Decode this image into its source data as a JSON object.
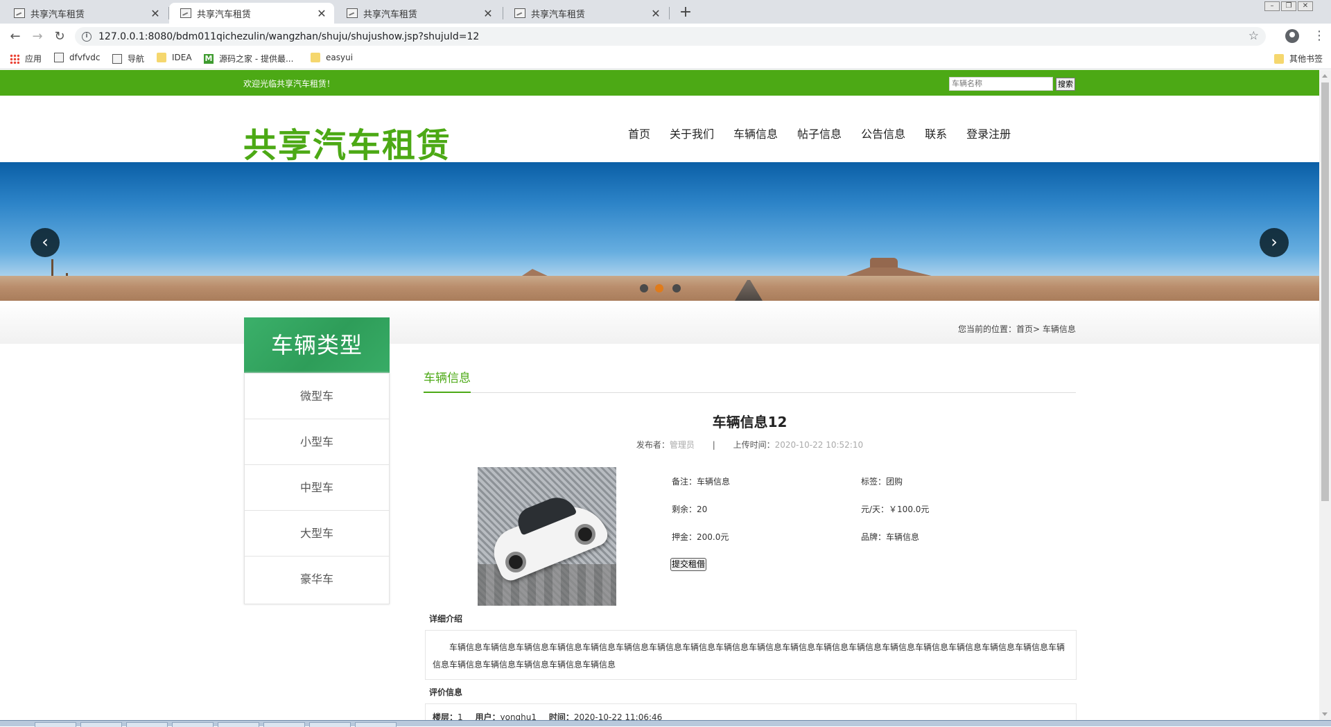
{
  "browser": {
    "tabs": [
      {
        "title": "共享汽车租赁",
        "active": false
      },
      {
        "title": "共享汽车租赁",
        "active": true
      },
      {
        "title": "共享汽车租赁",
        "active": false
      },
      {
        "title": "共享汽车租赁",
        "active": false
      }
    ],
    "url": "127.0.0.1:8080/bdm011qichezulin/wangzhan/shuju/shujushow.jsp?shujuId=12",
    "bookmarks": [
      "应用",
      "dfvfvdc",
      "导航",
      "IDEA",
      "源码之家 - 提供最...",
      "easyui"
    ],
    "other_bookmarks": "其他书签"
  },
  "topbar": {
    "welcome": "欢迎光临共享汽车租赁！",
    "search_placeholder": "车辆名称",
    "search_button": "搜索"
  },
  "header": {
    "logo": "共享汽车租赁",
    "nav": [
      "首页",
      "关于我们",
      "车辆信息",
      "帖子信息",
      "公告信息",
      "联系",
      "登录注册"
    ]
  },
  "banner": {
    "slides": 3,
    "active_slide": 2,
    "prev_icon": "chevron-left-icon",
    "next_icon": "chevron-right-icon"
  },
  "breadcrumb": {
    "prefix": "您当前的位置：",
    "home": "首页",
    "separator": ">",
    "current": "车辆信息"
  },
  "sidebar": {
    "title": "车辆类型",
    "items": [
      "微型车",
      "小型车",
      "中型车",
      "大型车",
      "豪华车"
    ]
  },
  "main": {
    "section_label": "车辆信息",
    "title": "车辆信息12",
    "meta": {
      "publisher_label": "发布者：",
      "publisher": "管理员",
      "divider": "|",
      "time_label": "上传时间：",
      "time": "2020-10-22 10:52:10"
    },
    "details": {
      "remark": "备注：车辆信息",
      "tag": "标签：团购",
      "remaining": "剩余：20",
      "price": "元/天：￥100.0元",
      "deposit": "押金：200.0元",
      "brand": "品牌：车辆信息"
    },
    "submit_button": "提交租借",
    "detail_heading": "详细介绍",
    "detail_text": "车辆信息车辆信息车辆信息车辆信息车辆信息车辆信息车辆信息车辆信息车辆信息车辆信息车辆信息车辆信息车辆信息车辆信息车辆信息车辆信息车辆信息车辆信息车辆信息车辆信息车辆信息车辆信息车辆信息车辆信息",
    "review_heading": "评价信息",
    "review": {
      "floor_label": "楼层：",
      "floor": "1",
      "user_label": "用户：",
      "user": "yonghu1",
      "time_label": "时间：",
      "time": "2020-10-22 11:06:46"
    }
  },
  "colors": {
    "brand_green": "#4ca915",
    "sidebar_green": "#2e9d59",
    "active_dot": "#e07b1a"
  }
}
